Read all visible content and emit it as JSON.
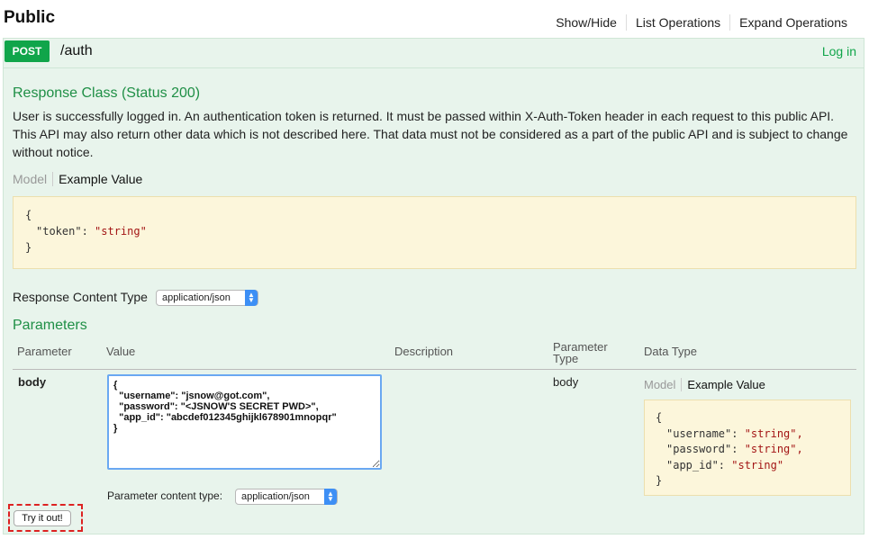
{
  "header": {
    "title": "Public",
    "links": [
      "Show/Hide",
      "List Operations",
      "Expand Operations"
    ]
  },
  "operation": {
    "method": "POST",
    "path": "/auth",
    "login_label": "Log in",
    "method_color": "#10a54a"
  },
  "response": {
    "heading": "Response Class (Status 200)",
    "description": "User is successfully logged in. An authentication token is returned. It must be passed within X-Auth-Token header in each request to this public API. This API may also return other data which is not described here. That data must not be considered as a part of the public API and is subject to change without notice.",
    "tabs": {
      "model": "Model",
      "example": "Example Value"
    },
    "example": {
      "open": "{",
      "key": "\"token\"",
      "value": "\"string\"",
      "close": "}"
    },
    "content_type_label": "Response Content Type",
    "content_type_value": "application/json"
  },
  "parameters": {
    "heading": "Parameters",
    "columns": {
      "parameter": "Parameter",
      "value": "Value",
      "description": "Description",
      "parameter_type": "Parameter Type",
      "data_type": "Data Type"
    },
    "row": {
      "name": "body",
      "value": "{\n  \"username\": \"jsnow@got.com\",\n  \"password\": \"<JSNOW'S SECRET PWD>\",\n  \"app_id\": \"abcdef012345ghijkl678901mnopqr\"\n}",
      "param_type": "body",
      "tabs": {
        "model": "Model",
        "example": "Example Value"
      },
      "example": {
        "open": "{",
        "fields": [
          {
            "key": "\"username\"",
            "value": "\"string\","
          },
          {
            "key": "\"password\"",
            "value": "\"string\","
          },
          {
            "key": "\"app_id\"",
            "value": "\"string\""
          }
        ],
        "close": "}"
      },
      "content_type_label": "Parameter content type:",
      "content_type_value": "application/json"
    }
  },
  "try_button": "Try it out!",
  "highlight_color": "#dd2222"
}
